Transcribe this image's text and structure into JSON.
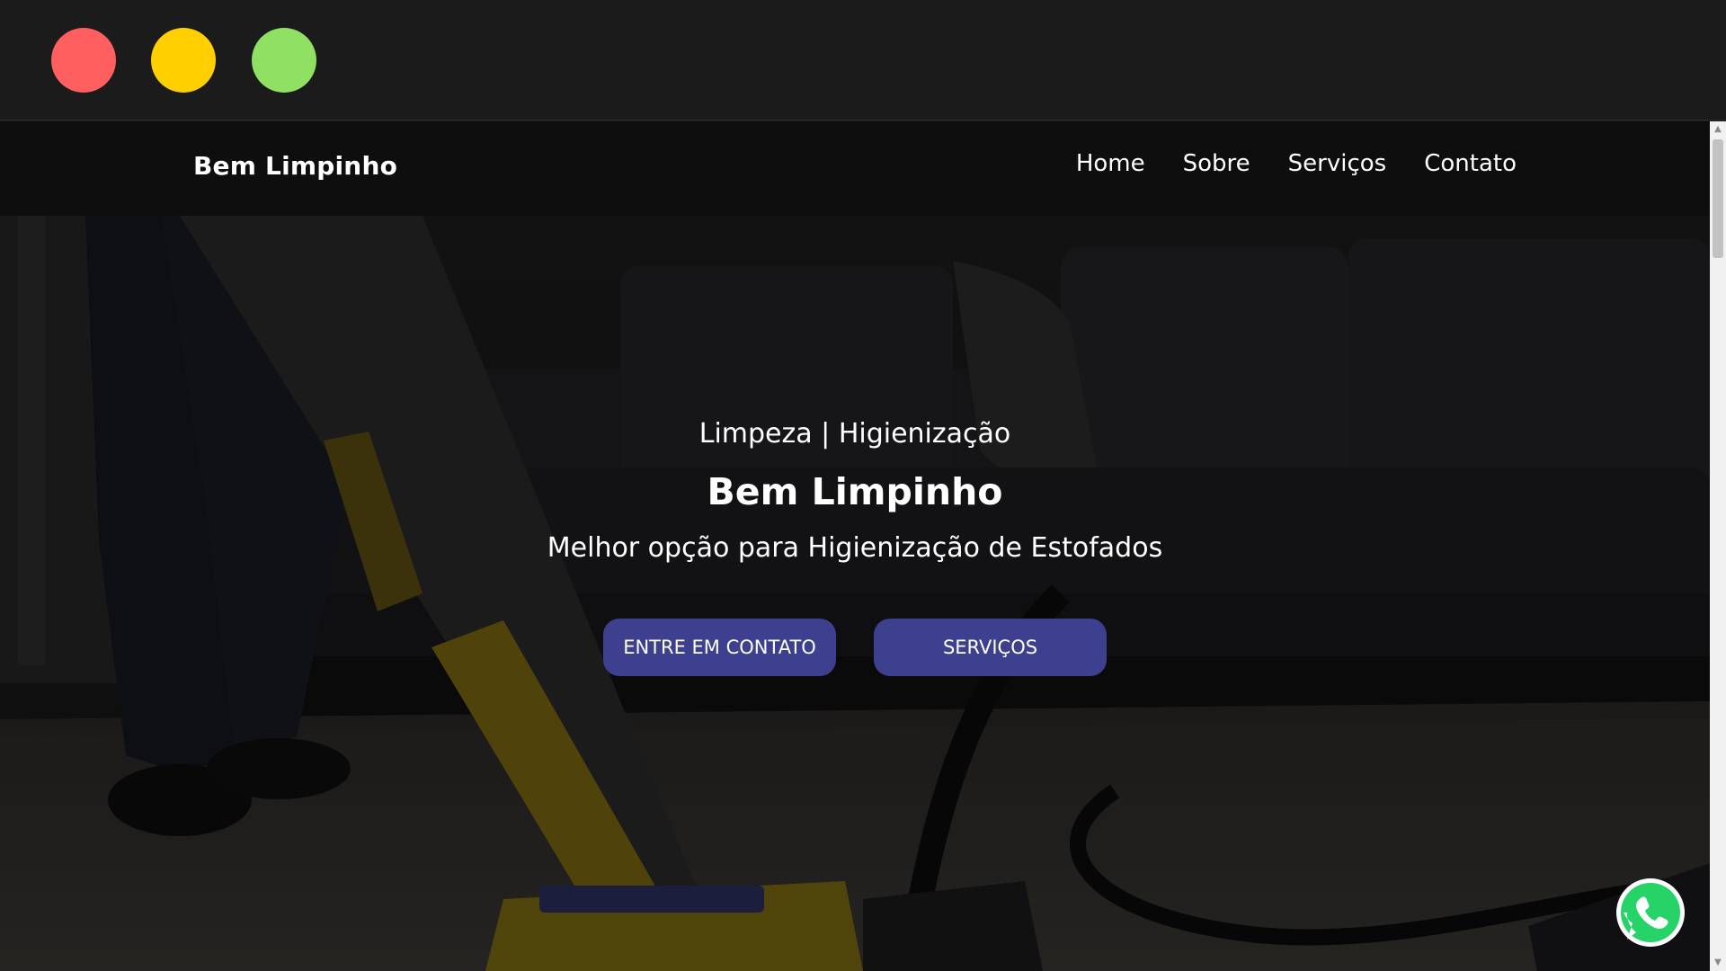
{
  "window": {
    "controls": [
      {
        "name": "close",
        "color": "#ff5f5f"
      },
      {
        "name": "minimize",
        "color": "#ffcf00"
      },
      {
        "name": "maximize",
        "color": "#8fe063"
      }
    ]
  },
  "navbar": {
    "brand": "Bem Limpinho",
    "links": [
      "Home",
      "Sobre",
      "Serviços",
      "Contato"
    ]
  },
  "hero": {
    "tagline": "Limpeza | Higienização",
    "title": "Bem Limpinho",
    "subtitle": "Melhor opção para Higienização de Estofados",
    "buttons": {
      "contact": "ENTRE EM CONTATO",
      "services": "SERVIÇOS"
    },
    "background_image": "person vacuuming carpet in front of dark sofa"
  },
  "floating": {
    "icon": "whatsapp-icon",
    "color": "#25d366"
  },
  "colors": {
    "button": "#3d3f8f",
    "navbar": "#0e0e0e"
  }
}
